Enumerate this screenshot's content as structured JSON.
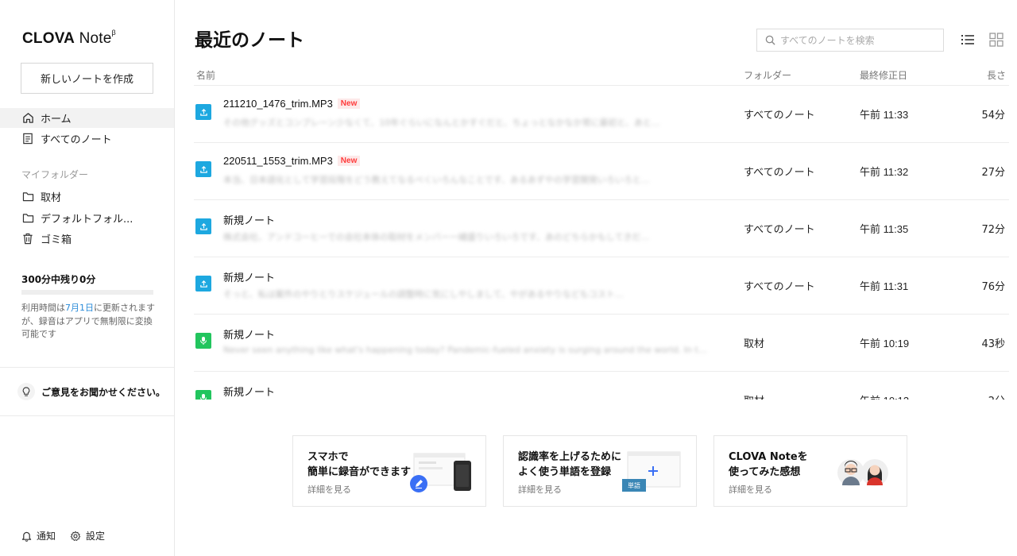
{
  "sidebar": {
    "logo_main": "CLOVA",
    "logo_note": " Note",
    "logo_beta": "β",
    "new_note_label": "新しいノートを作成",
    "nav": [
      {
        "label": "ホーム",
        "icon": "home-icon"
      },
      {
        "label": "すべてのノート",
        "icon": "document-icon"
      }
    ],
    "my_folders_label": "マイフォルダー",
    "folders": [
      {
        "label": "取材",
        "icon": "folder-icon"
      },
      {
        "label": "デフォルトフォル...",
        "icon": "folder-icon"
      },
      {
        "label": "ゴミ箱",
        "icon": "trash-icon"
      }
    ],
    "usage": {
      "title": "300分中残り0分",
      "fill_fraction": 0,
      "desc_prefix": "利用時間は",
      "desc_link": "7月1日",
      "desc_suffix": "に更新されますが、録音はアプリで無制限に変換可能です"
    },
    "feedback_label": "ご意見をお聞かせください。",
    "notifications_label": "通知",
    "settings_label": "設定"
  },
  "main": {
    "title": "最近のノート",
    "search_placeholder": "すべてのノートを検索",
    "columns": {
      "name": "名前",
      "folder": "フォルダー",
      "modified": "最終修正日",
      "length": "長さ"
    },
    "rows": [
      {
        "name": "211210_1476_trim.MP3",
        "badge": "New",
        "type": "upload",
        "preview": "その他グッズとコンプレーン少なくて、10年ぐらいになんとかすぐだと、ちょっとなかなか常に最初と、あと…",
        "folder": "すべてのノート",
        "date": "午前 11:33",
        "length": "54分"
      },
      {
        "name": "220511_1553_trim.MP3",
        "badge": "New",
        "type": "upload",
        "preview": "本当、日本語化として学習段階をどう教えてなるべくいろんなことです、あるあずやの学習開発いろいろと…",
        "folder": "すべてのノート",
        "date": "午前 11:32",
        "length": "27分"
      },
      {
        "name": "新規ノート",
        "badge": "",
        "type": "upload",
        "preview": "株式会社、アンドコーヒーでの会社本体の取材をメンバー一緒盛りいろいろです、あのどちらかもしてきだ…",
        "folder": "すべてのノート",
        "date": "午前 11:35",
        "length": "72分"
      },
      {
        "name": "新規ノート",
        "badge": "",
        "type": "upload",
        "preview": "そっと、私は案件のやりとりスケジュールの調整時に気にしやしまして、やがあるやりなどもコスト…",
        "folder": "すべてのノート",
        "date": "午前 11:31",
        "length": "76分"
      },
      {
        "name": "新規ノート",
        "badge": "",
        "type": "record",
        "preview": "Never seen anything like what's happening today? Pandemic-fueled anxiety is surging around the world. In t…",
        "folder": "取材",
        "date": "午前 10:19",
        "length": "43秒"
      },
      {
        "name": "新規ノート",
        "badge": "",
        "type": "record",
        "preview": "",
        "folder": "取材",
        "date": "午前 10:13",
        "length": "2分"
      }
    ]
  },
  "cards": [
    {
      "title": "スマホで\n簡単に録音ができます",
      "link": "詳細を見る"
    },
    {
      "title": "認識率を上げるために\nよく使う単語を登録",
      "link": "詳細を見る",
      "chip": "単語"
    },
    {
      "title": "CLOVA Noteを\n使ってみた感想",
      "link": "詳細を見る"
    }
  ],
  "colors": {
    "upload": "#1da8e0",
    "record": "#22c55e",
    "badge": "#ff3b3b",
    "accent": "#3a6ff5"
  }
}
